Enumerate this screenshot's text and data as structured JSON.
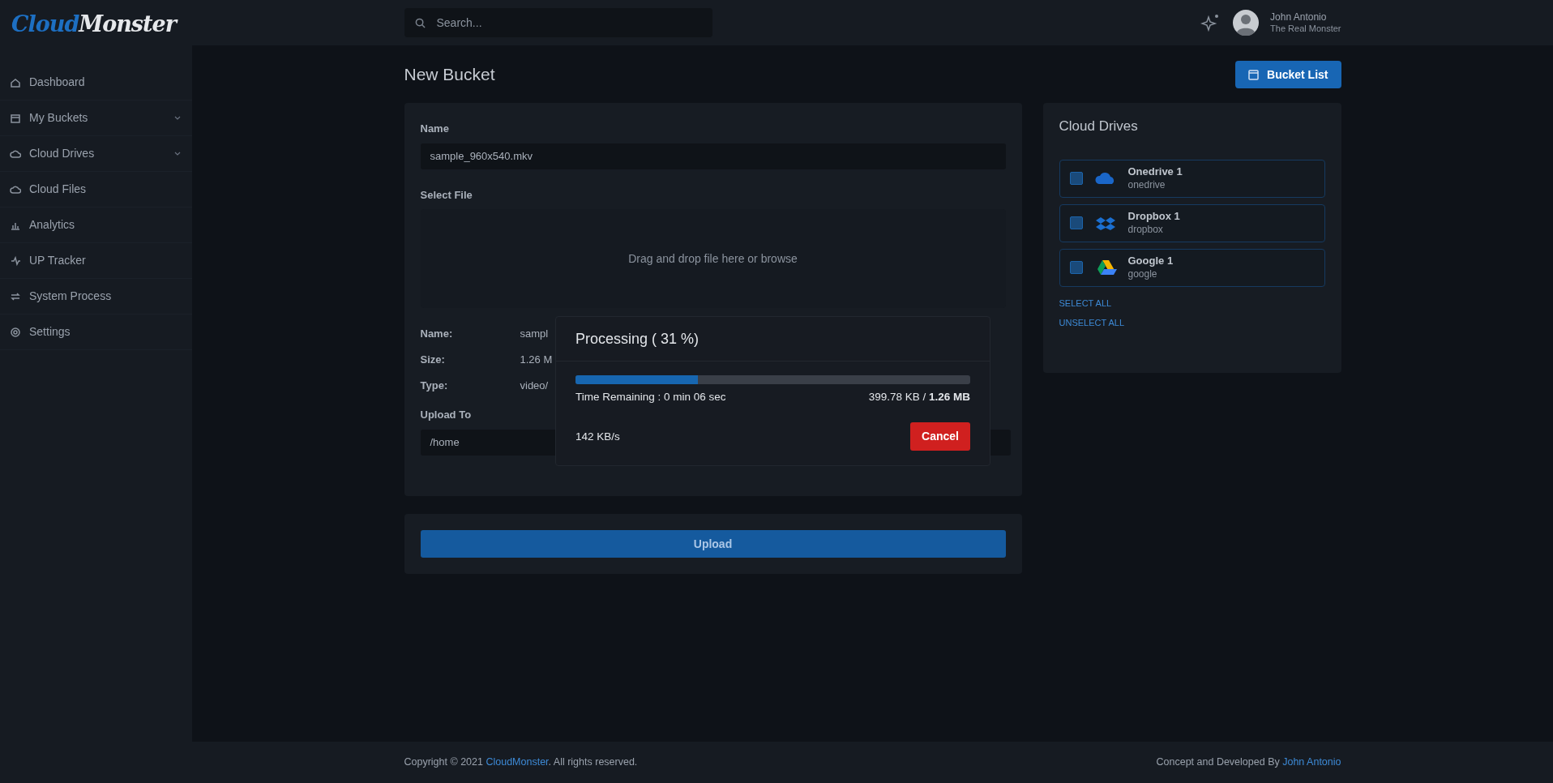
{
  "logo": {
    "first": "Cloud",
    "second": "Monster"
  },
  "search": {
    "placeholder": "Search..."
  },
  "user": {
    "name": "John Antonio",
    "role": "The Real Monster"
  },
  "sidebar": {
    "items": [
      {
        "label": "Dashboard",
        "has_submenu": false
      },
      {
        "label": "My Buckets",
        "has_submenu": true
      },
      {
        "label": "Cloud Drives",
        "has_submenu": true
      },
      {
        "label": "Cloud Files",
        "has_submenu": false
      },
      {
        "label": "Analytics",
        "has_submenu": false
      },
      {
        "label": "UP Tracker",
        "has_submenu": false
      },
      {
        "label": "System Process",
        "has_submenu": false
      },
      {
        "label": "Settings",
        "has_submenu": false
      }
    ]
  },
  "page_title": "New Bucket",
  "bucket_list_button": "Bucket List",
  "form": {
    "name_label": "Name",
    "name_value": "sample_960x540.mkv",
    "file_label": "Select File",
    "dropzone_text": "Drag and drop file here or browse",
    "file_info": [
      {
        "label": "Name:",
        "value": "sampl"
      },
      {
        "label": "Size:",
        "value": "1.26 M"
      },
      {
        "label": "Type:",
        "value": "video/"
      }
    ],
    "upload_to_label": "Upload To",
    "upload_to_value": "/home"
  },
  "upload_button": "Upload",
  "cloud_drives": {
    "title": "Cloud Drives",
    "items": [
      {
        "name": "Onedrive 1",
        "type": "onedrive",
        "checked": false
      },
      {
        "name": "Dropbox 1",
        "type": "dropbox",
        "checked": false
      },
      {
        "name": "Google 1",
        "type": "google",
        "checked": false
      }
    ],
    "select_all": "SELECT ALL",
    "unselect_all": "UNSELECT ALL"
  },
  "footer": {
    "copyright_before": "Copyright © 2021",
    "copyright_link": "CloudMonster",
    "copyright_after": ". All rights reserved.",
    "credit": "Concept and Developed By",
    "credit_link": "John Antonio"
  },
  "modal": {
    "title": "Processing ( 31 %)",
    "level": 0.31,
    "time_remaining": "Time Remaining : 0 min 06 sec",
    "transferred": "399.78 KB",
    "separator": "/",
    "total": "1.26 MB",
    "speed": "142 KB/s",
    "cancel": "Cancel"
  }
}
